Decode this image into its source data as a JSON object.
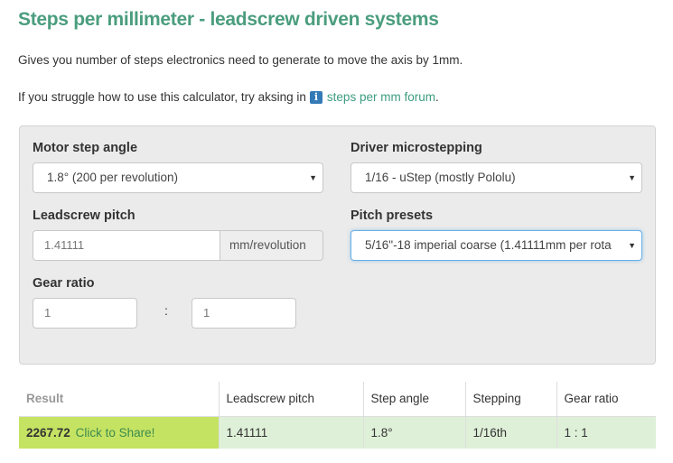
{
  "header": {
    "title": "Steps per millimeter - leadscrew driven systems",
    "description": "Gives you number of steps electronics need to generate to move the axis by 1mm.",
    "help_prefix": "If you struggle how to use this calculator, try aksing in",
    "help_link": "steps per mm forum",
    "help_suffix": "."
  },
  "form": {
    "motor_step_angle": {
      "label": "Motor step angle",
      "value": "1.8° (200 per revolution)"
    },
    "driver_microstepping": {
      "label": "Driver microstepping",
      "value": "1/16 - uStep (mostly Pololu)"
    },
    "leadscrew_pitch": {
      "label": "Leadscrew pitch",
      "placeholder": "1.41111",
      "unit": "mm/revolution"
    },
    "pitch_presets": {
      "label": "Pitch presets",
      "value": "5/16\"-18 imperial coarse (1.41111mm per rota"
    },
    "gear_ratio": {
      "label": "Gear ratio",
      "left_placeholder": "1",
      "separator": ":",
      "right_placeholder": "1"
    }
  },
  "results": {
    "headers": [
      "Result",
      "Leadscrew pitch",
      "Step angle",
      "Stepping",
      "Gear ratio"
    ],
    "result_value": "2267.72",
    "share_label": "Click to Share!",
    "row": [
      "1.41111",
      "1.8°",
      "1/16th",
      "1 : 1"
    ]
  },
  "icons": {
    "info": "info-icon",
    "dropdown": "caret-down-icon"
  },
  "colors": {
    "title": "#4a9d7e",
    "link": "#3c9c80",
    "result_highlight": "#c5e362",
    "result_row": "#dff0d8"
  }
}
